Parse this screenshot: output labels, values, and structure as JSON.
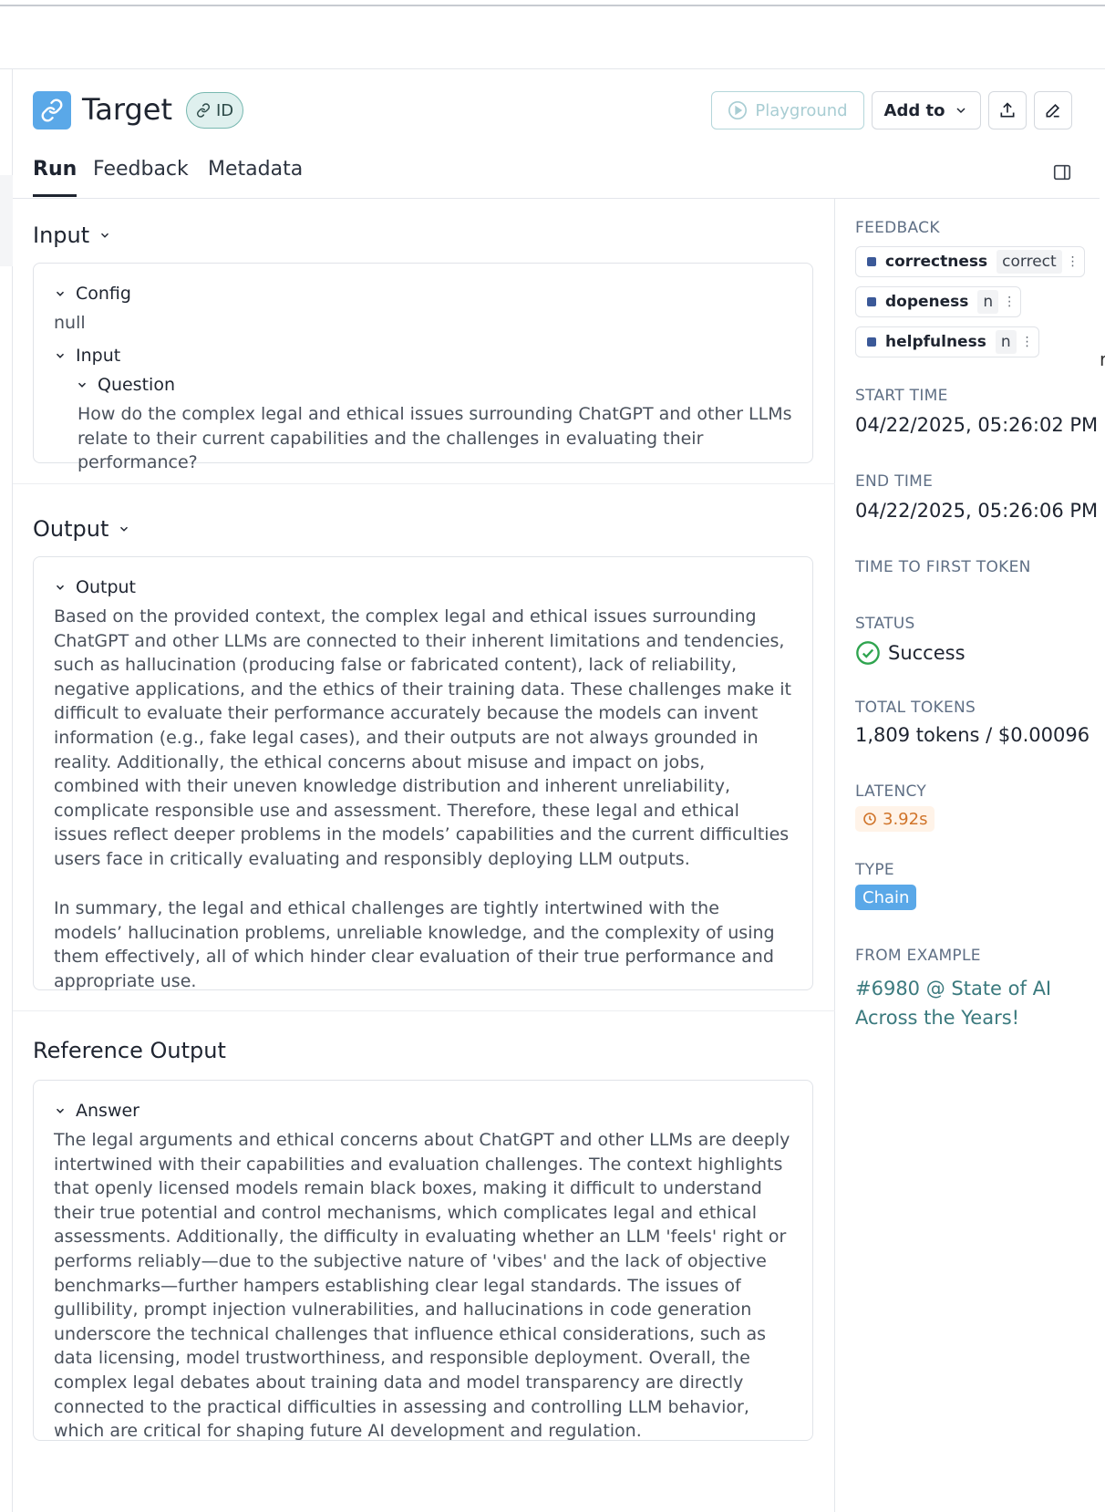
{
  "header": {
    "title": "Target",
    "id_badge": "ID",
    "playground_label": "Playground",
    "add_to_label": "Add to"
  },
  "tabs": [
    {
      "label": "Run",
      "active": true
    },
    {
      "label": "Feedback",
      "active": false
    },
    {
      "label": "Metadata",
      "active": false
    }
  ],
  "input_section": {
    "heading": "Input",
    "config_label": "Config",
    "config_value": "null",
    "input_label": "Input",
    "question_label": "Question",
    "question_text": "How do the complex legal and ethical issues surrounding ChatGPT and other LLMs relate to their current capabilities and the challenges in evaluating their performance?"
  },
  "output_section": {
    "heading": "Output",
    "output_label": "Output",
    "paragraph_1": "Based on the provided context, the complex legal and ethical issues surrounding ChatGPT and other LLMs are connected to their inherent limitations and tendencies, such as hallucination (producing false or fabricated content), lack of reliability, negative applications, and the ethics of their training data. These challenges make it difficult to evaluate their performance accurately because the models can invent information (e.g., fake legal cases), and their outputs are not always grounded in reality. Additionally, the ethical concerns about misuse and impact on jobs, combined with their uneven knowledge distribution and inherent unreliability, complicate responsible use and assessment. Therefore, these legal and ethical issues reflect deeper problems in the models’ capabilities and the current difficulties users face in critically evaluating and responsibly deploying LLM outputs.",
    "paragraph_2": "In summary, the legal and ethical challenges are tightly intertwined with the models’ hallucination problems, unreliable knowledge, and the complexity of using them effectively, all of which hinder clear evaluation of their true performance and appropriate use."
  },
  "reference_section": {
    "heading": "Reference Output",
    "answer_label": "Answer",
    "answer_text": "The legal arguments and ethical concerns about ChatGPT and other LLMs are deeply intertwined with their capabilities and evaluation challenges. The context highlights that openly licensed models remain black boxes, making it difficult to understand their true potential and control mechanisms, which complicates legal and ethical assessments. Additionally, the difficulty in evaluating whether an LLM 'feels' right or performs reliably—due to the subjective nature of 'vibes' and the lack of objective benchmarks—further hampers establishing clear legal standards. The issues of gullibility, prompt injection vulnerabilities, and hallucinations in code generation underscore the technical challenges that influence ethical considerations, such as data licensing, model trustworthiness, and responsible deployment. Overall, the complex legal debates about training data and model transparency are directly connected to the practical difficulties in assessing and controlling LLM behavior, which are critical for shaping future AI development and regulation."
  },
  "sidebar": {
    "feedback_label": "FEEDBACK",
    "feedback": [
      {
        "key": "correctness",
        "value": "correct"
      },
      {
        "key": "dopeness",
        "value": "n"
      },
      {
        "key": "helpfulness",
        "value": "n"
      }
    ],
    "start_time_label": "START TIME",
    "start_time": "04/22/2025, 05:26:02 PM",
    "end_time_label": "END TIME",
    "end_time": "04/22/2025, 05:26:06 PM",
    "ttft_label": "TIME TO FIRST TOKEN",
    "status_label": "STATUS",
    "status": "Success",
    "total_tokens_label": "TOTAL TOKENS",
    "total_tokens": "1,809 tokens / $0.00096",
    "latency_label": "LATENCY",
    "latency": "3.92s",
    "type_label": "TYPE",
    "type": "Chain",
    "from_example_label": "FROM EXAMPLE",
    "from_example": "#6980 @ State of AI Across the Years!"
  },
  "colors": {
    "accent_blue": "#5aa8e8",
    "teal_link": "#3b7a7e",
    "success_green": "#2fa44f",
    "latency_orange": "#d0742a",
    "feedback_dot": "#3b5998"
  }
}
